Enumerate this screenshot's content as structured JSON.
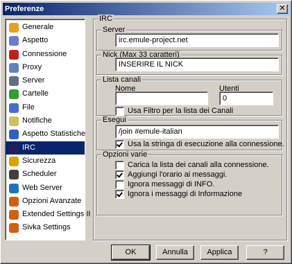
{
  "window": {
    "title": "Preferenze",
    "close_symbol": "✕"
  },
  "nav": {
    "items": [
      {
        "label": "Generale",
        "icon": "gear-icon",
        "color": "#e8a020"
      },
      {
        "label": "Aspetto",
        "icon": "palette-icon",
        "color": "#6a7fd0"
      },
      {
        "label": "Connessione",
        "icon": "plug-icon",
        "color": "#c02020"
      },
      {
        "label": "Proxy",
        "icon": "proxy-icon",
        "color": "#6080c0"
      },
      {
        "label": "Server",
        "icon": "server-icon",
        "color": "#607080"
      },
      {
        "label": "Cartelle",
        "icon": "folder-icon",
        "color": "#30a030"
      },
      {
        "label": "File",
        "icon": "file-icon",
        "color": "#4a6ad0"
      },
      {
        "label": "Notifiche",
        "icon": "notify-icon",
        "color": "#d0c060"
      },
      {
        "label": "Aspetto Statistiche",
        "icon": "stats-icon",
        "color": "#3060c0"
      },
      {
        "label": "IRC",
        "icon": "irc-icon",
        "color": "#202060",
        "selected": true
      },
      {
        "label": "Sicurezza",
        "icon": "shield-icon",
        "color": "#e0a000"
      },
      {
        "label": "Scheduler",
        "icon": "clock-icon",
        "color": "#404040"
      },
      {
        "label": "Web Server",
        "icon": "globe-icon",
        "color": "#2070c0"
      },
      {
        "label": "Opzioni Avanzate",
        "icon": "advanced-icon",
        "color": "#d06010"
      },
      {
        "label": "Extended Settings II",
        "icon": "extended-icon",
        "color": "#d06010"
      },
      {
        "label": "Sivka Settings",
        "icon": "sivka-icon",
        "color": "#d06010"
      }
    ]
  },
  "irc": {
    "title": "IRC",
    "server": {
      "title": "Server",
      "value": "irc.emule-project.net"
    },
    "nick": {
      "title": "Nick (Max 33 caratteri)",
      "value": "INSERIRE IL NICK"
    },
    "channels": {
      "title": "Lista canali",
      "name_label": "Nome",
      "name_value": "",
      "users_label": "Utenti",
      "users_value": "0",
      "filter_label": "Usa Filtro per la lista dei Canali",
      "filter_checked": false
    },
    "exec": {
      "title": "Esegui",
      "value": "/join #emule-italian",
      "use_label": "Usa la stringa di esecuzione alla connessione.",
      "use_checked": true
    },
    "options": {
      "title": "Opzioni varie",
      "items": [
        {
          "label": "Carica la lista dei canali alla connessione.",
          "checked": false
        },
        {
          "label": "Aggiungi l'orario ai messaggi.",
          "checked": true
        },
        {
          "label": "Ignora messaggi di INFO.",
          "checked": false
        },
        {
          "label": "Ignora i messaggi di Informazione",
          "checked": true
        }
      ]
    }
  },
  "buttons": {
    "ok": "OK",
    "cancel": "Annulla",
    "apply": "Applica",
    "help": "?"
  }
}
